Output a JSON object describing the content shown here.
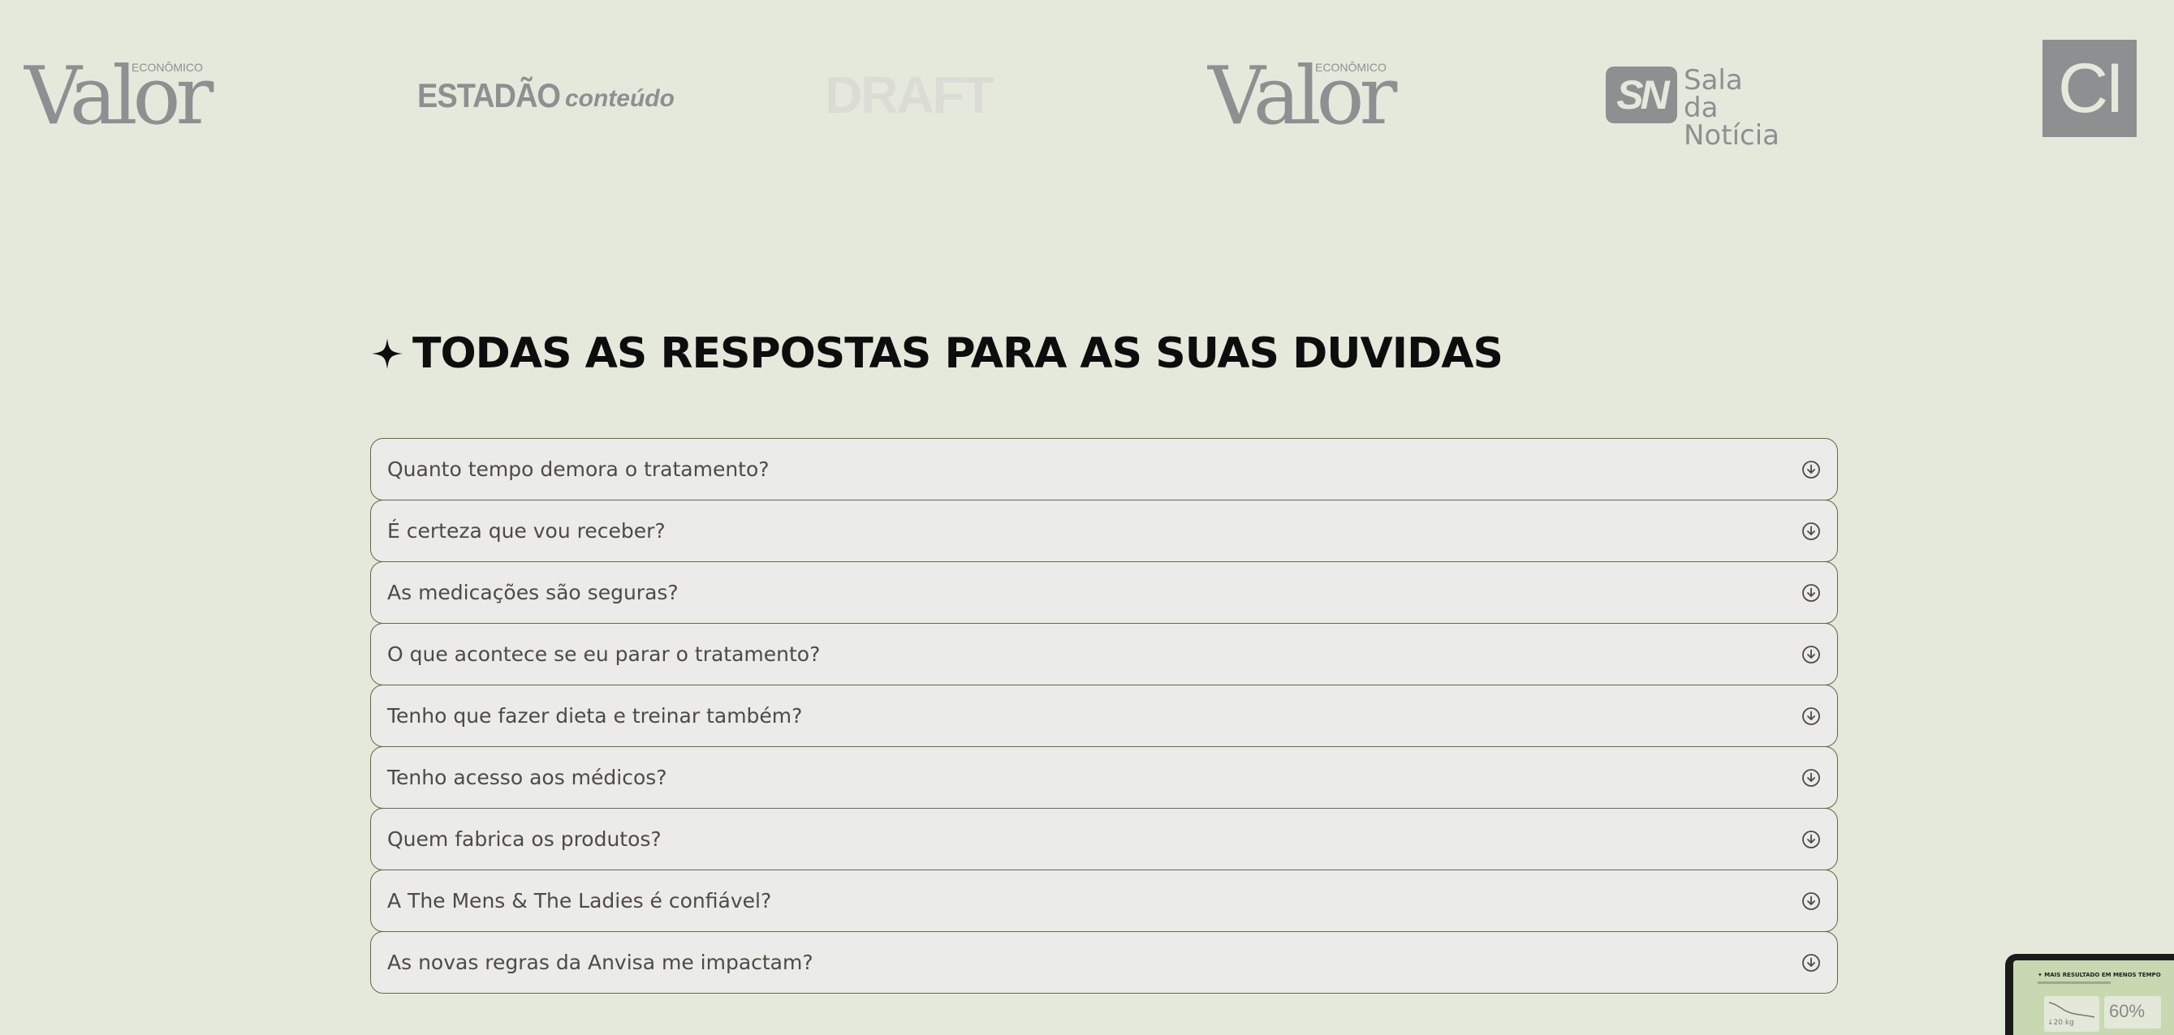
{
  "logos": {
    "valor_small": "ECONÔMICO",
    "valor_big": "Valor",
    "estadao_main": "ESTADÃO",
    "estadao_sub": "conteúdo",
    "draft": "DRAFT",
    "sn_mark": "SN",
    "sn_line1": "Sala da",
    "sn_line2": "Notícia",
    "ci_mark": "CI"
  },
  "faq": {
    "title": "TODAS AS RESPOSTAS PARA AS SUAS DUVIDAS",
    "items": [
      {
        "question": "Quanto tempo demora o tratamento?"
      },
      {
        "question": "É certeza que vou receber?"
      },
      {
        "question": "As medicações são seguras?"
      },
      {
        "question": "O que acontece se eu parar o tratamento?"
      },
      {
        "question": "Tenho que fazer dieta e treinar também?"
      },
      {
        "question": "Tenho acesso aos médicos?"
      },
      {
        "question": "Quem fabrica os produtos?"
      },
      {
        "question": "A The Mens & The Ladies é confiável?"
      },
      {
        "question": "As novas regras da Anvisa me impactam?"
      }
    ]
  },
  "preview": {
    "title": "✦ MAIS RESULTADO EM MENOS TEMPO",
    "weight": "↓20 kg",
    "percent": "60%"
  },
  "colors": {
    "background": "#e5e9dc",
    "logo_gray": "#8e8f91",
    "item_border": "#66683f",
    "item_bg": "#ebebea",
    "title": "#0d0d0d"
  },
  "icons": {
    "title_star": "four-point-star",
    "accordion": "circle-arrow-down"
  }
}
